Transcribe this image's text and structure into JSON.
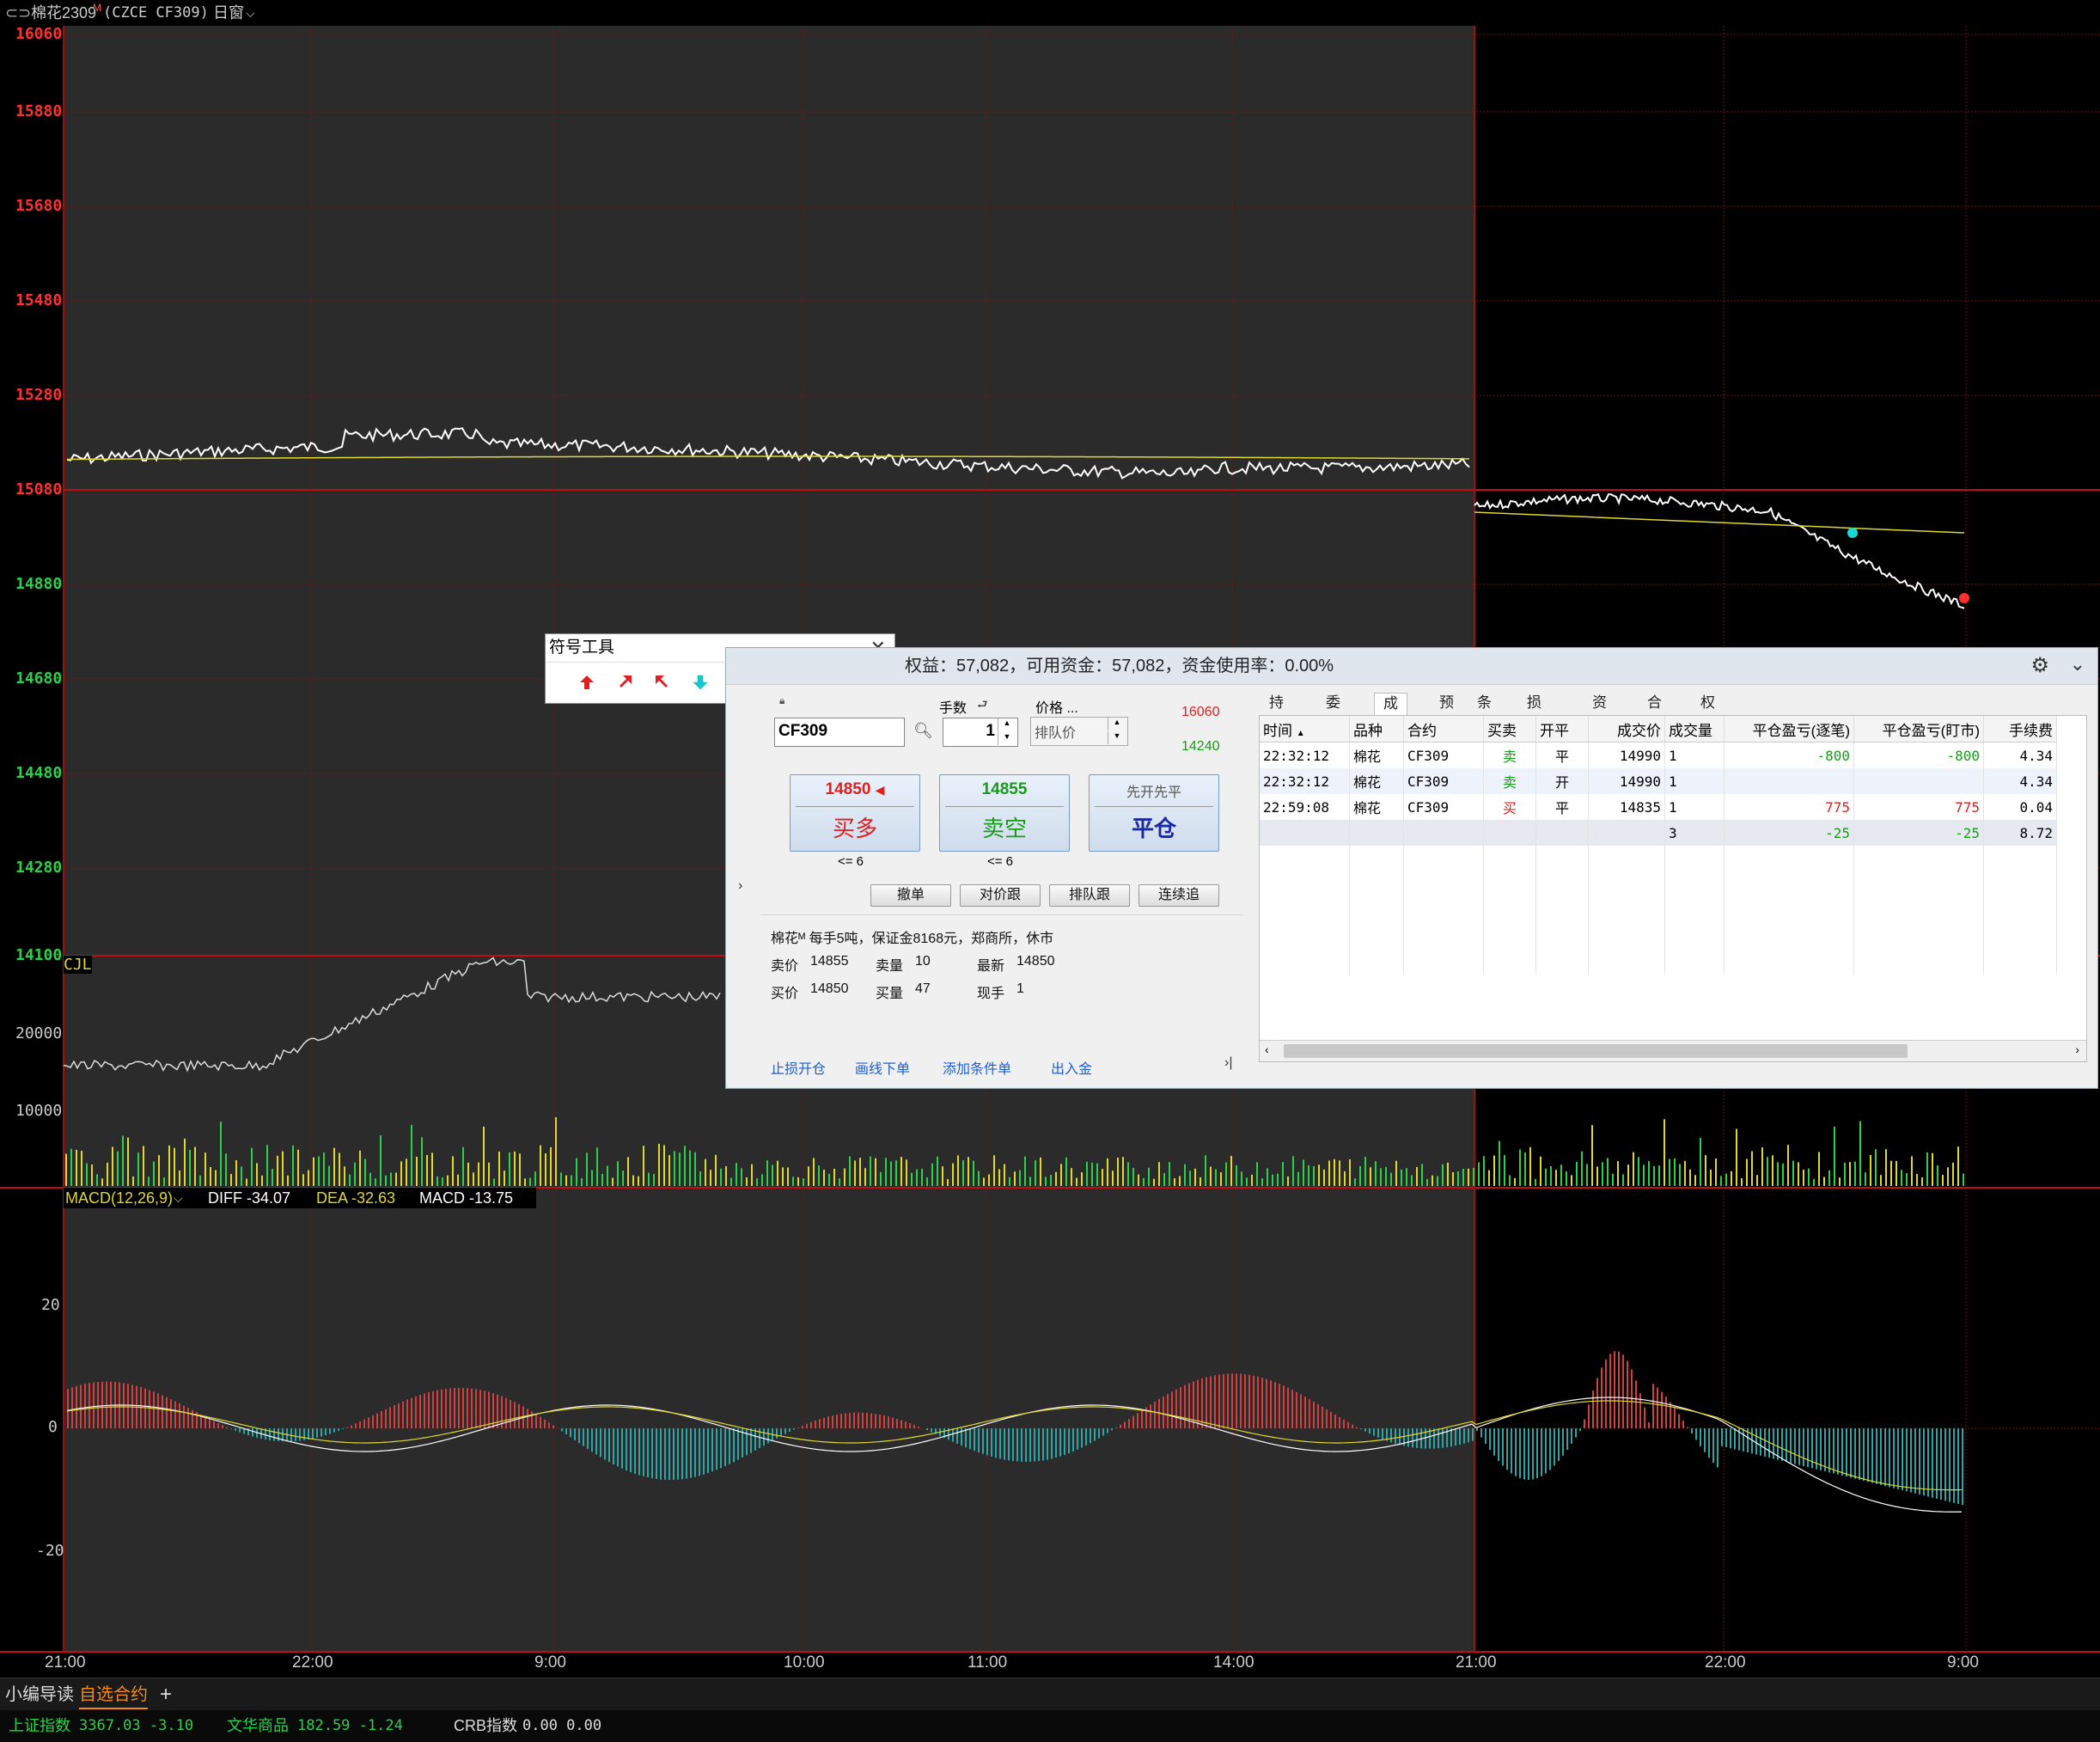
{
  "titlebar": {
    "contract_name": "棉花2309",
    "superscript": "M",
    "exchange_code": "(CZCE CF309)",
    "period": "日窗"
  },
  "price_axis": [
    "16060",
    "15880",
    "15680",
    "15480",
    "15280",
    "15080",
    "14880",
    "14680",
    "14480",
    "14280",
    "14100"
  ],
  "volume_axis": {
    "label": "CJL",
    "ticks": [
      "20000",
      "10000"
    ]
  },
  "macd": {
    "label": "MACD(12,26,9)",
    "diff": "DIFF -34.07",
    "dea": "DEA -32.63",
    "macd": "MACD -13.75",
    "ticks": [
      "20",
      "0",
      "-20"
    ]
  },
  "time_axis": [
    "21:00",
    "22:00",
    "9:00",
    "10:00",
    "11:00",
    "14:00",
    "21:00",
    "22:00",
    "9:00"
  ],
  "colors": {
    "up": "#ff3030",
    "down": "#2bd14a",
    "yellow": "#e0d830",
    "macd_red": "#d24040",
    "macd_cyan": "#2aa6a6",
    "grid": "#7a1010"
  },
  "symbol_tool": {
    "title": "符号工具",
    "close_icon": "close-icon",
    "icons": [
      "arrow-up-red-icon",
      "arrow-upright-red-icon",
      "arrow-upleft-red-icon",
      "arrow-down-cyan-icon",
      "arrow-downright-cyan-icon",
      "arrow-downleft-cyan-icon",
      "dot-red-icon",
      "dot-cyan-icon"
    ]
  },
  "trade": {
    "header": "权益：57,082，可用资金：57,082，资金使用率：0.00%",
    "contract_input": "CF309",
    "qty_label": "手数",
    "qty_value": "1",
    "price_label": "价格 ...",
    "price_placeholder": "排队价",
    "limit_up": "16060",
    "limit_down": "14240",
    "buy": {
      "price": "14850",
      "label": "买多",
      "limit": "<= 6"
    },
    "sell": {
      "price": "14855",
      "label": "卖空",
      "limit": "<= 6"
    },
    "close": {
      "price": "先开先平",
      "label": "平仓"
    },
    "small_buttons": [
      "撤单",
      "对价跟",
      "排队跟",
      "连续追"
    ],
    "info": {
      "line1": "棉花ᴹ  每手5吨，保证金8168元，郑商所，休市",
      "ask_label": "卖价",
      "ask": "14855",
      "ask_vol_label": "卖量",
      "ask_vol": "10",
      "last_label": "最新",
      "last": "14850",
      "bid_label": "买价",
      "bid": "14850",
      "bid_vol_label": "买量",
      "bid_vol": "47",
      "cur_label": "现手",
      "cur": "1"
    },
    "links": [
      "止损开仓",
      "画线下单",
      "添加条件单",
      "出入金"
    ],
    "tabs": [
      "持仓",
      "委托",
      "成交",
      "预备单",
      "条件单",
      "损盈单",
      "资金",
      "合约",
      "权益图"
    ],
    "active_tab": "成交",
    "columns": [
      "时间",
      "品种",
      "合约",
      "买卖",
      "开平",
      "成交价",
      "成交量",
      "平仓盈亏(逐笔)",
      "平仓盈亏(盯市)",
      "手续费"
    ],
    "rows": [
      [
        "22:32:12",
        "棉花",
        "CF309",
        "卖",
        "平",
        "14990",
        "1",
        "-800",
        "-800",
        "4.34"
      ],
      [
        "22:32:12",
        "棉花",
        "CF309",
        "卖",
        "开",
        "14990",
        "1",
        "",
        "",
        "4.34"
      ],
      [
        "22:59:08",
        "棉花",
        "CF309",
        "买",
        "平",
        "14835",
        "1",
        "775",
        "775",
        "0.04"
      ]
    ],
    "summary": [
      "",
      "",
      "",
      "",
      "",
      "",
      "3",
      "-25",
      "-25",
      "8.72"
    ]
  },
  "bottom_tabs": [
    "小编导读",
    "自选合约",
    "+"
  ],
  "status": {
    "sh_label": "上证指数",
    "sh_value": "3367.03 -3.10",
    "wh_label": "文华商品",
    "wh_value": "182.59 -1.24",
    "crb_label": "CRB指数",
    "crb_value": "0.00 0.00"
  }
}
